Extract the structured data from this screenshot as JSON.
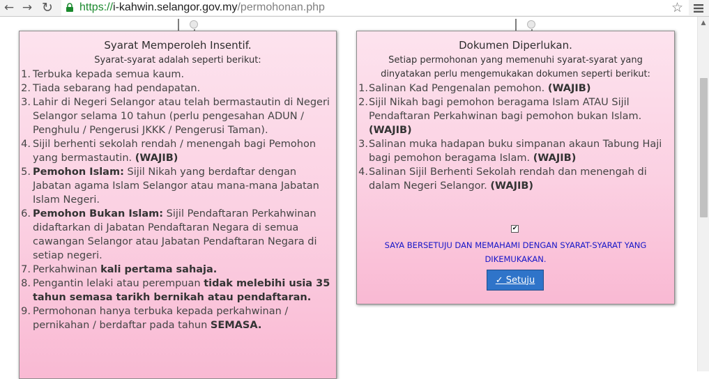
{
  "browser": {
    "url_scheme": "https://",
    "url_host": "i-kahwin.selangor.gov.my",
    "url_path": "/permohonan.php",
    "back_glyph": "←",
    "forward_glyph": "→",
    "reload_glyph": "↻",
    "star_glyph": "☆"
  },
  "left_card": {
    "title": "Syarat Memperoleh Insentif.",
    "subtitle": "Syarat-syarat adalah seperti berikut:",
    "items": [
      {
        "num": "1.",
        "a": "Terbuka kepada semua kaum."
      },
      {
        "num": "2.",
        "a": "Tiada sebarang had pendapatan."
      },
      {
        "num": "3.",
        "a": "Lahir di Negeri Selangor atau telah bermastautin di Negeri Selangor selama 10 tahun (perlu pengesahan ADUN / Penghulu / Pengerusi JKKK / Pengerusi Taman)."
      },
      {
        "num": "4.",
        "a": "Sijil berhenti sekolah rendah / menengah bagi Pemohon yang bermastautin. ",
        "b": "(WAJIB)"
      },
      {
        "num": "5.",
        "a": "",
        "b": "Pemohon Islam:",
        "c": " Sijil Nikah yang berdaftar dengan Jabatan agama Islam Selangor atau mana-mana Jabatan Islam Negeri."
      },
      {
        "num": "6.",
        "a": "",
        "b": "Pemohon Bukan Islam:",
        "c": " Sijil Pendaftaran Perkahwinan didaftarkan di Jabatan Pendaftaran Negara di semua cawangan Selangor atau Jabatan Pendaftaran Negara di setiap negeri."
      },
      {
        "num": "7.",
        "a": "Perkahwinan ",
        "b": "kali pertama sahaja."
      },
      {
        "num": "8.",
        "a": "Pengantin lelaki atau perempuan ",
        "b": "tidak melebihi usia 35 tahun semasa tarikh bernikah atau pendaftaran."
      },
      {
        "num": "9.",
        "a": "Permohonan hanya terbuka kepada perkahwinan / pernikahan / berdaftar pada tahun ",
        "b": "SEMASA."
      }
    ]
  },
  "right_card": {
    "title": "Dokumen Diperlukan.",
    "subtitle": "Setiap permohonan yang memenuhi syarat-syarat yang dinyatakan perlu mengemukakan dokumen seperti berikut:",
    "items": [
      {
        "num": "1.",
        "a": "Salinan Kad Pengenalan pemohon. ",
        "b": "(WAJIB)"
      },
      {
        "num": "2.",
        "a": "Sijil Nikah bagi pemohon beragama Islam ATAU Sijil Pendaftaran Perkahwinan bagi pemohon bukan Islam. ",
        "b": "(WAJIB)"
      },
      {
        "num": "3.",
        "a": "Salinan muka hadapan buku simpanan akaun Tabung Haji bagi pemohon beragama Islam. ",
        "b": "(WAJIB)"
      },
      {
        "num": "4.",
        "a": "Salinan Sijil Berhenti Sekolah rendah dan menengah di dalam Negeri Selangor. ",
        "b": "(WAJIB)"
      }
    ],
    "checkbox_checked": true,
    "checkbox_glyph": "✔",
    "agree_text": "SAYA BERSETUJU DAN MEMAHAMI DENGAN SYARAT-SYARAT YANG DIKEMUKAKAN.",
    "button_label": "✓ Setuju"
  },
  "colors": {
    "card_pink_top": "#fde3ee",
    "card_pink_bottom": "#f9b9d3",
    "agree_text": "#1515c8",
    "button_blue": "#2f74c9",
    "url_green": "#1b8a2e"
  }
}
